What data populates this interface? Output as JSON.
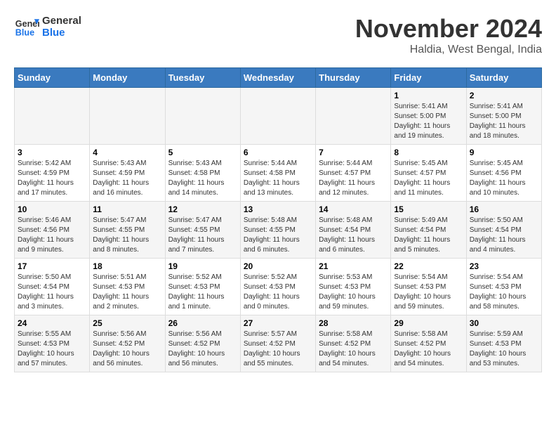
{
  "logo": {
    "line1": "General",
    "line2": "Blue"
  },
  "title": "November 2024",
  "location": "Haldia, West Bengal, India",
  "headers": [
    "Sunday",
    "Monday",
    "Tuesday",
    "Wednesday",
    "Thursday",
    "Friday",
    "Saturday"
  ],
  "weeks": [
    [
      {
        "day": "",
        "info": ""
      },
      {
        "day": "",
        "info": ""
      },
      {
        "day": "",
        "info": ""
      },
      {
        "day": "",
        "info": ""
      },
      {
        "day": "",
        "info": ""
      },
      {
        "day": "1",
        "info": "Sunrise: 5:41 AM\nSunset: 5:00 PM\nDaylight: 11 hours and 19 minutes."
      },
      {
        "day": "2",
        "info": "Sunrise: 5:41 AM\nSunset: 5:00 PM\nDaylight: 11 hours and 18 minutes."
      }
    ],
    [
      {
        "day": "3",
        "info": "Sunrise: 5:42 AM\nSunset: 4:59 PM\nDaylight: 11 hours and 17 minutes."
      },
      {
        "day": "4",
        "info": "Sunrise: 5:43 AM\nSunset: 4:59 PM\nDaylight: 11 hours and 16 minutes."
      },
      {
        "day": "5",
        "info": "Sunrise: 5:43 AM\nSunset: 4:58 PM\nDaylight: 11 hours and 14 minutes."
      },
      {
        "day": "6",
        "info": "Sunrise: 5:44 AM\nSunset: 4:58 PM\nDaylight: 11 hours and 13 minutes."
      },
      {
        "day": "7",
        "info": "Sunrise: 5:44 AM\nSunset: 4:57 PM\nDaylight: 11 hours and 12 minutes."
      },
      {
        "day": "8",
        "info": "Sunrise: 5:45 AM\nSunset: 4:57 PM\nDaylight: 11 hours and 11 minutes."
      },
      {
        "day": "9",
        "info": "Sunrise: 5:45 AM\nSunset: 4:56 PM\nDaylight: 11 hours and 10 minutes."
      }
    ],
    [
      {
        "day": "10",
        "info": "Sunrise: 5:46 AM\nSunset: 4:56 PM\nDaylight: 11 hours and 9 minutes."
      },
      {
        "day": "11",
        "info": "Sunrise: 5:47 AM\nSunset: 4:55 PM\nDaylight: 11 hours and 8 minutes."
      },
      {
        "day": "12",
        "info": "Sunrise: 5:47 AM\nSunset: 4:55 PM\nDaylight: 11 hours and 7 minutes."
      },
      {
        "day": "13",
        "info": "Sunrise: 5:48 AM\nSunset: 4:55 PM\nDaylight: 11 hours and 6 minutes."
      },
      {
        "day": "14",
        "info": "Sunrise: 5:48 AM\nSunset: 4:54 PM\nDaylight: 11 hours and 6 minutes."
      },
      {
        "day": "15",
        "info": "Sunrise: 5:49 AM\nSunset: 4:54 PM\nDaylight: 11 hours and 5 minutes."
      },
      {
        "day": "16",
        "info": "Sunrise: 5:50 AM\nSunset: 4:54 PM\nDaylight: 11 hours and 4 minutes."
      }
    ],
    [
      {
        "day": "17",
        "info": "Sunrise: 5:50 AM\nSunset: 4:54 PM\nDaylight: 11 hours and 3 minutes."
      },
      {
        "day": "18",
        "info": "Sunrise: 5:51 AM\nSunset: 4:53 PM\nDaylight: 11 hours and 2 minutes."
      },
      {
        "day": "19",
        "info": "Sunrise: 5:52 AM\nSunset: 4:53 PM\nDaylight: 11 hours and 1 minute."
      },
      {
        "day": "20",
        "info": "Sunrise: 5:52 AM\nSunset: 4:53 PM\nDaylight: 11 hours and 0 minutes."
      },
      {
        "day": "21",
        "info": "Sunrise: 5:53 AM\nSunset: 4:53 PM\nDaylight: 10 hours and 59 minutes."
      },
      {
        "day": "22",
        "info": "Sunrise: 5:54 AM\nSunset: 4:53 PM\nDaylight: 10 hours and 59 minutes."
      },
      {
        "day": "23",
        "info": "Sunrise: 5:54 AM\nSunset: 4:53 PM\nDaylight: 10 hours and 58 minutes."
      }
    ],
    [
      {
        "day": "24",
        "info": "Sunrise: 5:55 AM\nSunset: 4:53 PM\nDaylight: 10 hours and 57 minutes."
      },
      {
        "day": "25",
        "info": "Sunrise: 5:56 AM\nSunset: 4:52 PM\nDaylight: 10 hours and 56 minutes."
      },
      {
        "day": "26",
        "info": "Sunrise: 5:56 AM\nSunset: 4:52 PM\nDaylight: 10 hours and 56 minutes."
      },
      {
        "day": "27",
        "info": "Sunrise: 5:57 AM\nSunset: 4:52 PM\nDaylight: 10 hours and 55 minutes."
      },
      {
        "day": "28",
        "info": "Sunrise: 5:58 AM\nSunset: 4:52 PM\nDaylight: 10 hours and 54 minutes."
      },
      {
        "day": "29",
        "info": "Sunrise: 5:58 AM\nSunset: 4:52 PM\nDaylight: 10 hours and 54 minutes."
      },
      {
        "day": "30",
        "info": "Sunrise: 5:59 AM\nSunset: 4:53 PM\nDaylight: 10 hours and 53 minutes."
      }
    ]
  ]
}
